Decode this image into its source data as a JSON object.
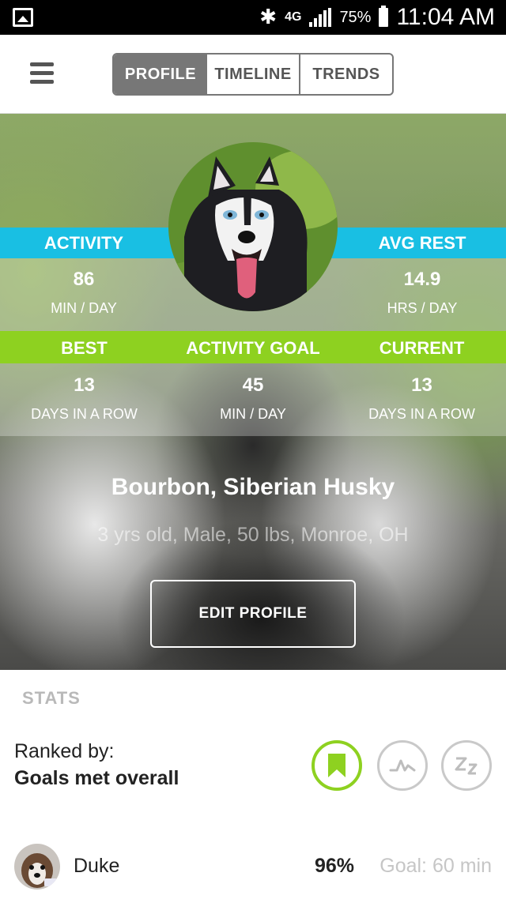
{
  "status_bar": {
    "network": "4G",
    "battery": "75%",
    "time": "11:04 AM"
  },
  "nav": {
    "tabs": [
      {
        "label": "PROFILE",
        "active": true
      },
      {
        "label": "TIMELINE",
        "active": false
      },
      {
        "label": "TRENDS",
        "active": false
      }
    ]
  },
  "metrics": {
    "activity": {
      "label": "ACTIVITY",
      "value": "86",
      "unit": "MIN / DAY"
    },
    "avg_rest": {
      "label": "AVG REST",
      "value": "14.9",
      "unit": "HRS / DAY"
    },
    "best": {
      "label": "BEST",
      "value": "13",
      "unit": "DAYS IN A ROW"
    },
    "activity_goal": {
      "label": "ACTIVITY GOAL",
      "value": "45",
      "unit": "MIN / DAY"
    },
    "current": {
      "label": "CURRENT",
      "value": "13",
      "unit": "DAYS IN A ROW"
    }
  },
  "profile": {
    "name": "Bourbon, Siberian Husky",
    "details": "3 yrs old, Male, 50 lbs, Monroe, OH",
    "edit_label": "EDIT PROFILE"
  },
  "stats": {
    "title": "STATS",
    "ranked_by_label": "Ranked by:",
    "ranked_by_value": "Goals met overall",
    "rank_buttons": [
      "bookmark-icon",
      "activity-wave-icon",
      "sleep-zz-icon"
    ],
    "rows": [
      {
        "name": "Duke",
        "percent": "96%",
        "goal": "Goal: 60 min"
      }
    ]
  },
  "colors": {
    "blue_band": "#19bfe3",
    "green_band": "#8ed120",
    "nav_gray": "#777777"
  }
}
